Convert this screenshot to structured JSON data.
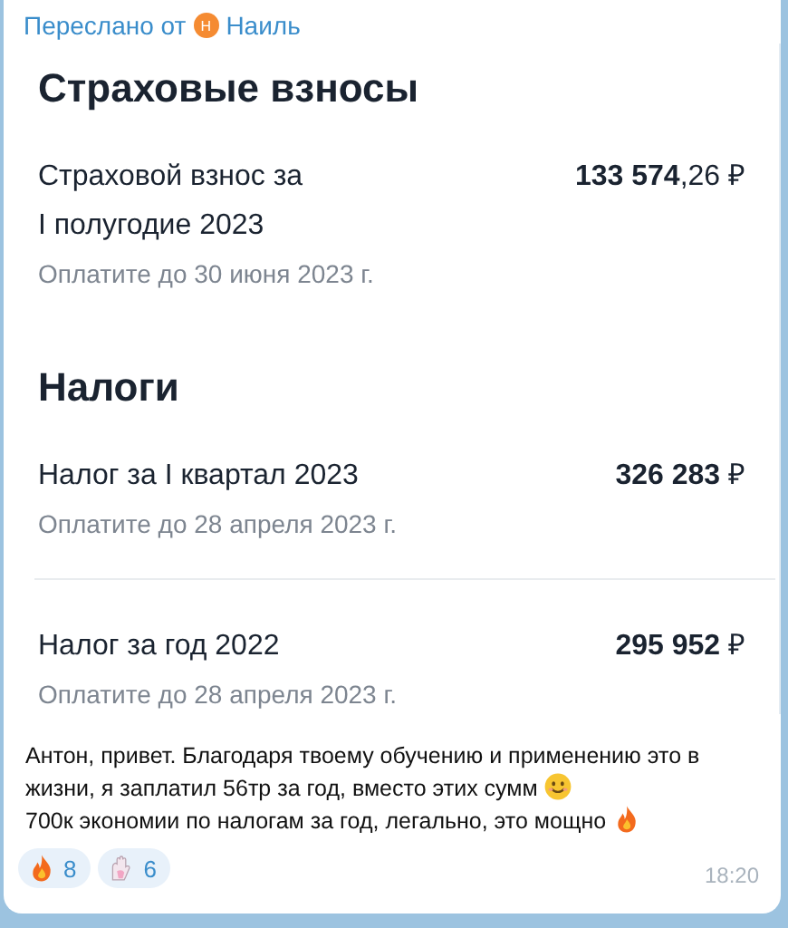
{
  "forwarded": {
    "label": "Переслано от",
    "avatar_letter": "Н",
    "name": "Наиль"
  },
  "screenshot": {
    "sections": [
      {
        "title": "Страховые взносы",
        "items": [
          {
            "name": "Страховой взнос за\nI полугодие 2023",
            "amount": "**133 574**,26 ₽",
            "due": "Оплатите до 30 июня 2023 г."
          }
        ]
      },
      {
        "title": "Налоги",
        "items": [
          {
            "name": "Налог за I квартал 2023",
            "amount": "**326 283** ₽",
            "due": "Оплатите до 28 апреля 2023 г."
          },
          {
            "name": "Налог за год 2022",
            "amount": "**295 952** ₽",
            "due": "Оплатите до 28 апреля 2023 г."
          }
        ]
      }
    ]
  },
  "message": {
    "lines": [
      {
        "text": "Антон, привет. Благодаря твоему обучению и применению это в",
        "kind": "plain"
      },
      {
        "text": "жизни, я заплатил 56тр за год, вместо этих сумм",
        "kind": "smile"
      },
      {
        "text": "700к экономии по налогам за год, легально, это мощно",
        "kind": "fire"
      }
    ]
  },
  "reactions": [
    {
      "kind": "fire",
      "count": "8"
    },
    {
      "kind": "hands",
      "count": "6"
    }
  ],
  "time": "18:20"
}
